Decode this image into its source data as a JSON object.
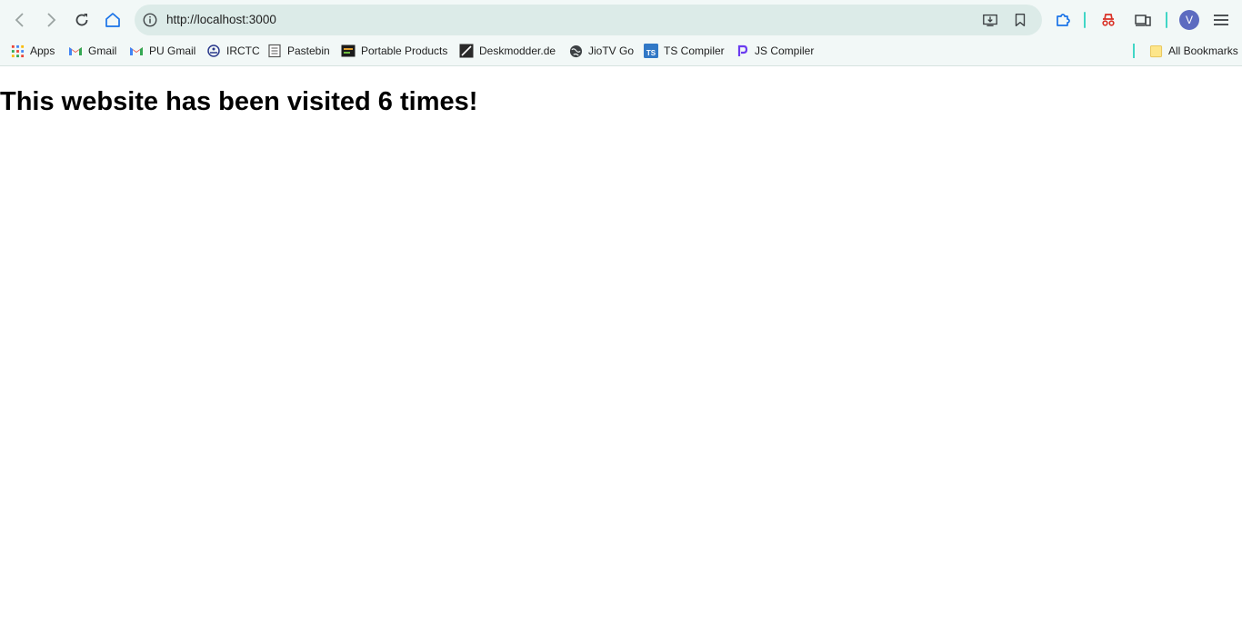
{
  "toolbar": {
    "url": "http://localhost:3000",
    "avatar_initial": "V"
  },
  "bookmarks": [
    {
      "label": "Apps",
      "icon": "apps-grid-icon"
    },
    {
      "label": "Gmail",
      "icon": "gmail-icon"
    },
    {
      "label": "PU Gmail",
      "icon": "gmail-icon"
    },
    {
      "label": "IRCTC",
      "icon": "irctc-icon"
    },
    {
      "label": "Pastebin",
      "icon": "pastebin-icon"
    },
    {
      "label": "Portable Products",
      "icon": "portable-products-icon"
    },
    {
      "label": "Deskmodder.de",
      "icon": "deskmodder-icon"
    },
    {
      "label": "JioTV Go",
      "icon": "globe-icon"
    },
    {
      "label": "TS Compiler",
      "icon": "ts-icon"
    },
    {
      "label": "JS Compiler",
      "icon": "js-compiler-icon"
    }
  ],
  "all_bookmarks_label": "All Bookmarks",
  "page": {
    "heading": "This website has been visited 6 times!"
  },
  "colors": {
    "chrome_bg": "#f2f8f7",
    "omnibox_bg": "#dcebe8",
    "accent_blue": "#1a73e8",
    "separator_teal": "#41d6c6",
    "avatar_bg": "#5c6bc0"
  }
}
